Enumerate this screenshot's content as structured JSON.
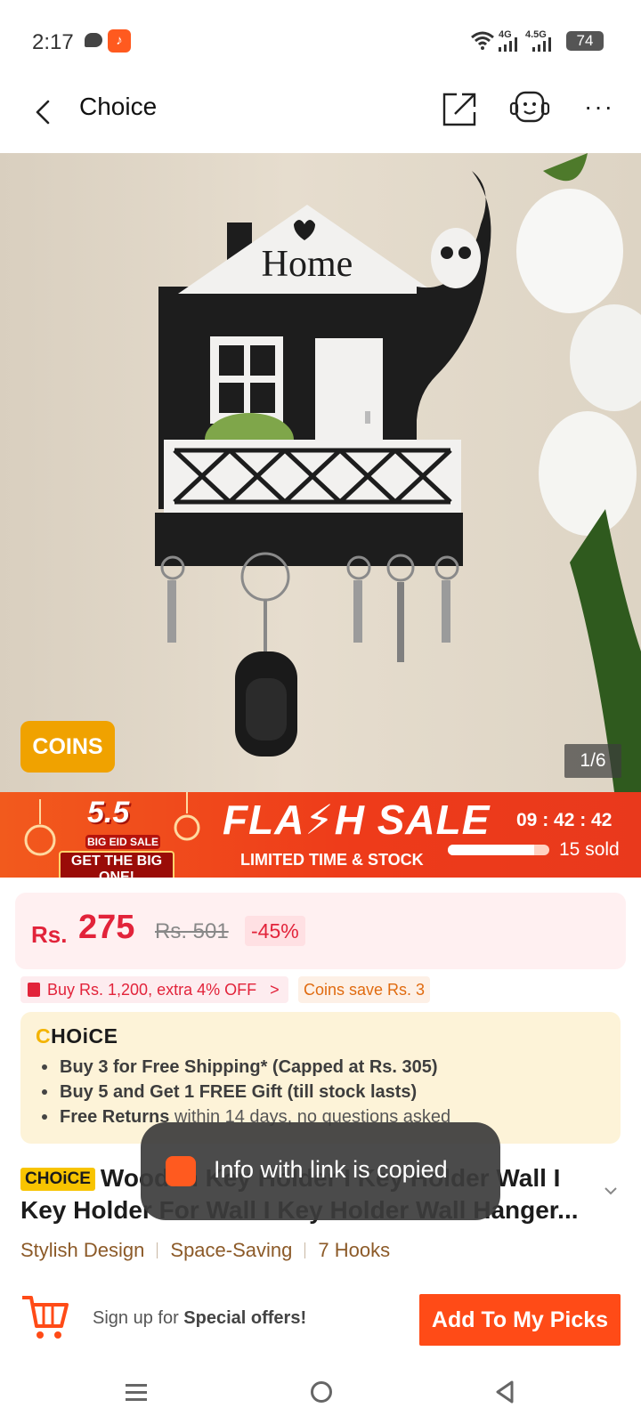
{
  "status_bar": {
    "time": "2:17",
    "app_icon_glyph": "♪",
    "net1": "4G",
    "net2": "4.5G",
    "battery": "74"
  },
  "header": {
    "title": "Choice"
  },
  "product_image": {
    "sign_text": "Home",
    "coins_badge": "COINS",
    "pager": "1/6"
  },
  "flash_sale": {
    "event_number": "5.5",
    "event_sub": "BIG EID SALE",
    "event_cta": "GET THE BIG ONE!",
    "title": "FLA⚡H SALE",
    "subtitle": "LIMITED TIME & STOCK",
    "countdown": "09 : 42 : 42",
    "sold_fraction": 0.15,
    "sold": "15 sold"
  },
  "price": {
    "currency": "Rs.",
    "current": "275",
    "original": "Rs. 501",
    "discount": "-45%"
  },
  "coupons": {
    "offer": "Buy Rs. 1,200, extra 4% OFF",
    "offer_arrow": ">",
    "coins": "Coins save Rs. 3"
  },
  "choice_box": {
    "logo_c": "C",
    "logo_rest": "HOiCE",
    "items": [
      {
        "bold": "Buy 3 for  Free Shipping* (Capped at Rs. 305)",
        "rest": ""
      },
      {
        "bold": "Buy 5 and Get 1 FREE Gift (till stock lasts)",
        "rest": ""
      },
      {
        "bold": "Free Returns",
        "rest": " within 14 days, no questions asked"
      }
    ]
  },
  "product": {
    "tag": "CHOiCE",
    "title": "Wooden Key Holder I Key Holder Wall I Key Holder For Wall I Key Holder Wall Hanger...",
    "features": [
      "Stylish Design",
      "Space-Saving",
      "7 Hooks"
    ]
  },
  "toast": {
    "message": "Info with link is copied"
  },
  "bottom_bar": {
    "signup_prefix": "Sign up for ",
    "signup_bold": "Special offers!",
    "cta": "Add To My Picks"
  },
  "colors": {
    "accent": "#ff4b17",
    "price_red": "#e2233a",
    "choice_yellow": "#f8c400",
    "feature_brown": "#8c5a28"
  }
}
